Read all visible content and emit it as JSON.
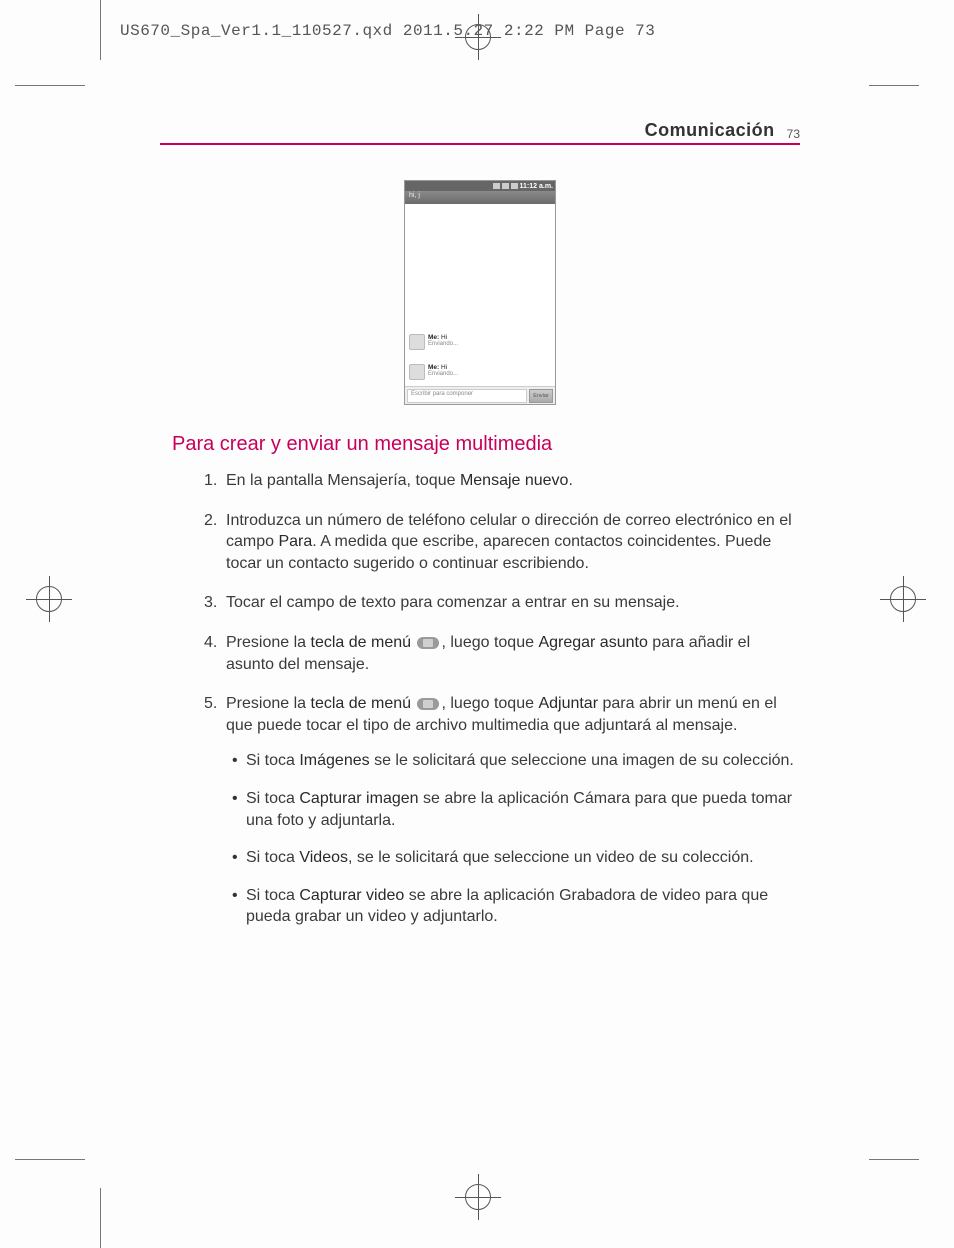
{
  "print_header": "US670_Spa_Ver1.1_110527.qxd  2011.5.27  2:22 PM  Page 73",
  "header": {
    "title": "Comunicación",
    "page": "73"
  },
  "phone": {
    "status_time": "11:12 a.m.",
    "titlebar": "hi, j",
    "msg1_name": "Me:",
    "msg1_text": "Hi",
    "msg1_status": "Enviando...",
    "msg2_name": "Me:",
    "msg2_text": "Hi",
    "msg2_status": "Enviando...",
    "compose_placeholder": "Escribir para componer",
    "send_label": "Enviar"
  },
  "section_heading": "Para crear y enviar un mensaje multimedia",
  "steps": {
    "s1": {
      "n": "1.",
      "a": "En la pantalla Mensajería, toque ",
      "b": "Mensaje nuevo",
      "c": "."
    },
    "s2": {
      "n": "2.",
      "a": "Introduzca un número de teléfono celular o dirección de correo electrónico en el campo ",
      "b": "Para",
      "c": ". A medida que escribe, aparecen contactos coincidentes. Puede tocar un contacto sugerido o continuar escribiendo."
    },
    "s3": {
      "n": "3.",
      "a": "Tocar el campo de texto para comenzar a entrar en su mensaje."
    },
    "s4": {
      "n": "4.",
      "a": "Presione la ",
      "b": "tecla de menú",
      "c": ", luego toque ",
      "d": "Agregar asunto",
      "e": " para añadir el asunto del mensaje."
    },
    "s5": {
      "n": "5.",
      "a": "Presione la ",
      "b": "tecla de menú",
      "c": ", luego toque ",
      "d": "Adjuntar",
      "e": " para abrir un menú en el que puede tocar el tipo de archivo multimedia que adjuntará al mensaje."
    }
  },
  "bullets": {
    "b1": {
      "a": "Si toca ",
      "b": "Imágenes",
      "c": " se le solicitará que seleccione una imagen de su colección."
    },
    "b2": {
      "a": "Si toca ",
      "b": "Capturar imagen",
      "c": " se abre la aplicación Cámara para que pueda tomar una foto y adjuntarla."
    },
    "b3": {
      "a": "Si toca ",
      "b": "Videos",
      "c": ", se le solicitará que seleccione un video de su colección."
    },
    "b4": {
      "a": "Si toca ",
      "b": "Capturar video",
      "c": " se abre la aplicación Grabadora de video para que pueda grabar un video y adjuntarlo."
    }
  }
}
